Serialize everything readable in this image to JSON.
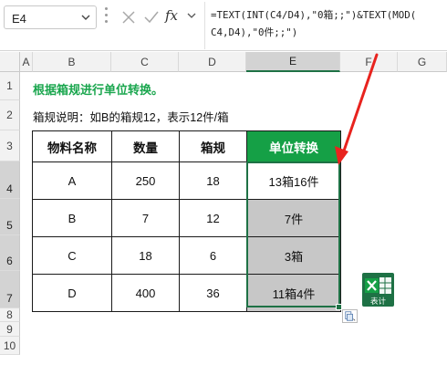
{
  "formula_bar": {
    "name_box": "E4",
    "fx_label": "fx",
    "formula_line1": "=TEXT(INT(C4/D4),\"0箱;;\")&TEXT(MOD(",
    "formula_line2": "C4,D4),\"0件;;\")"
  },
  "columns": [
    "A",
    "B",
    "C",
    "D",
    "E",
    "F",
    "G"
  ],
  "selected_column": "E",
  "rows": [
    "1",
    "2",
    "3",
    "4",
    "5",
    "6",
    "7",
    "8",
    "9",
    "10"
  ],
  "selected_rows": [
    "4",
    "5",
    "6",
    "7"
  ],
  "sheet": {
    "title": "根据箱规进行单位转换。",
    "note": "箱规说明：如B的箱规12，表示12件/箱"
  },
  "table": {
    "headers": [
      "物料名称",
      "数量",
      "箱规",
      "单位转换"
    ],
    "rows": [
      [
        "A",
        "250",
        "18",
        "13箱16件"
      ],
      [
        "B",
        "7",
        "12",
        "7件"
      ],
      [
        "C",
        "18",
        "6",
        "3箱"
      ],
      [
        "D",
        "400",
        "36",
        "11箱4件"
      ]
    ]
  },
  "logo": {
    "text": "表计",
    "icon": "excel-logo-icon"
  },
  "colors": {
    "title_green": "#1aa64e",
    "header_green": "#15a046",
    "selection_green": "#1e7145",
    "arrow_red": "#e8231e",
    "shaded_cell": "#c7c7c7"
  }
}
